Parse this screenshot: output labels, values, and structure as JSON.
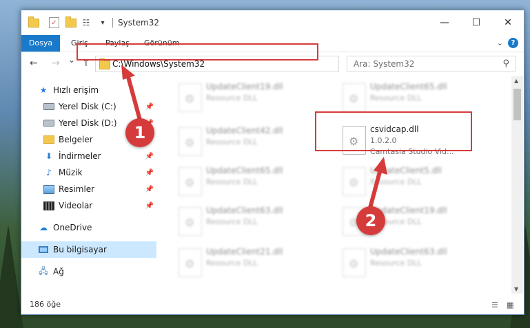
{
  "window": {
    "title": "System32"
  },
  "titlebar": {
    "minimize": "—",
    "maximize": "☐",
    "close": "✕"
  },
  "ribbon": {
    "tabs": [
      "Dosya",
      "Giriş",
      "Paylaş",
      "Görünüm"
    ],
    "help": "?"
  },
  "nav": {
    "back": "←",
    "forward": "→",
    "recent": "⌄",
    "up": "↑",
    "address": "C:\\Windows\\System32",
    "search_placeholder": "Ara: System32"
  },
  "sidebar": {
    "items": [
      {
        "label": "Hızlı erişim",
        "icon": "star-icon"
      },
      {
        "label": "Yerel Disk (C:)",
        "icon": "drive-icon",
        "pinned": true
      },
      {
        "label": "Yerel Disk (D:)",
        "icon": "drive-icon",
        "pinned": true
      },
      {
        "label": "Belgeler",
        "icon": "documents-icon",
        "pinned": true
      },
      {
        "label": "İndirmeler",
        "icon": "download-icon",
        "pinned": true
      },
      {
        "label": "Müzik",
        "icon": "music-icon",
        "pinned": true
      },
      {
        "label": "Resimler",
        "icon": "pictures-icon",
        "pinned": true
      },
      {
        "label": "Videolar",
        "icon": "videos-icon",
        "pinned": true
      },
      {
        "label": "OneDrive",
        "icon": "cloud-icon"
      },
      {
        "label": "Bu bilgisayar",
        "icon": "computer-icon",
        "selected": true
      },
      {
        "label": "Ağ",
        "icon": "network-icon"
      }
    ]
  },
  "files": {
    "left": [
      {
        "name": "UpdateClient19.dll",
        "type": "Resource DLL"
      },
      {
        "name": "UpdateClient42.dll",
        "type": "Resource DLL"
      },
      {
        "name": "UpdateClient65.dll",
        "type": "Resource DLL"
      },
      {
        "name": "UpdateClient63.dll",
        "type": "Resource DLL"
      },
      {
        "name": "UpdateClient21.dll",
        "type": "Resource DLL"
      }
    ],
    "right": [
      {
        "name": "UpdateClient65.dll",
        "type": "Resource DLL"
      },
      {
        "name": "UpdateClient5.dll",
        "type": "Resource DLL"
      },
      {
        "name": "UpdateClient19.dll",
        "type": "Resource DLL"
      },
      {
        "name": "UpdateClient63.dll",
        "type": "Resource DLL"
      }
    ],
    "highlighted": {
      "name": "csvidcap.dll",
      "version": "1.0.2.0",
      "description": "Camtasia Studio Vid..."
    }
  },
  "status": {
    "count": "186 öğe"
  },
  "annotations": {
    "step1": "1",
    "step2": "2",
    "color": "#d63b3b"
  }
}
